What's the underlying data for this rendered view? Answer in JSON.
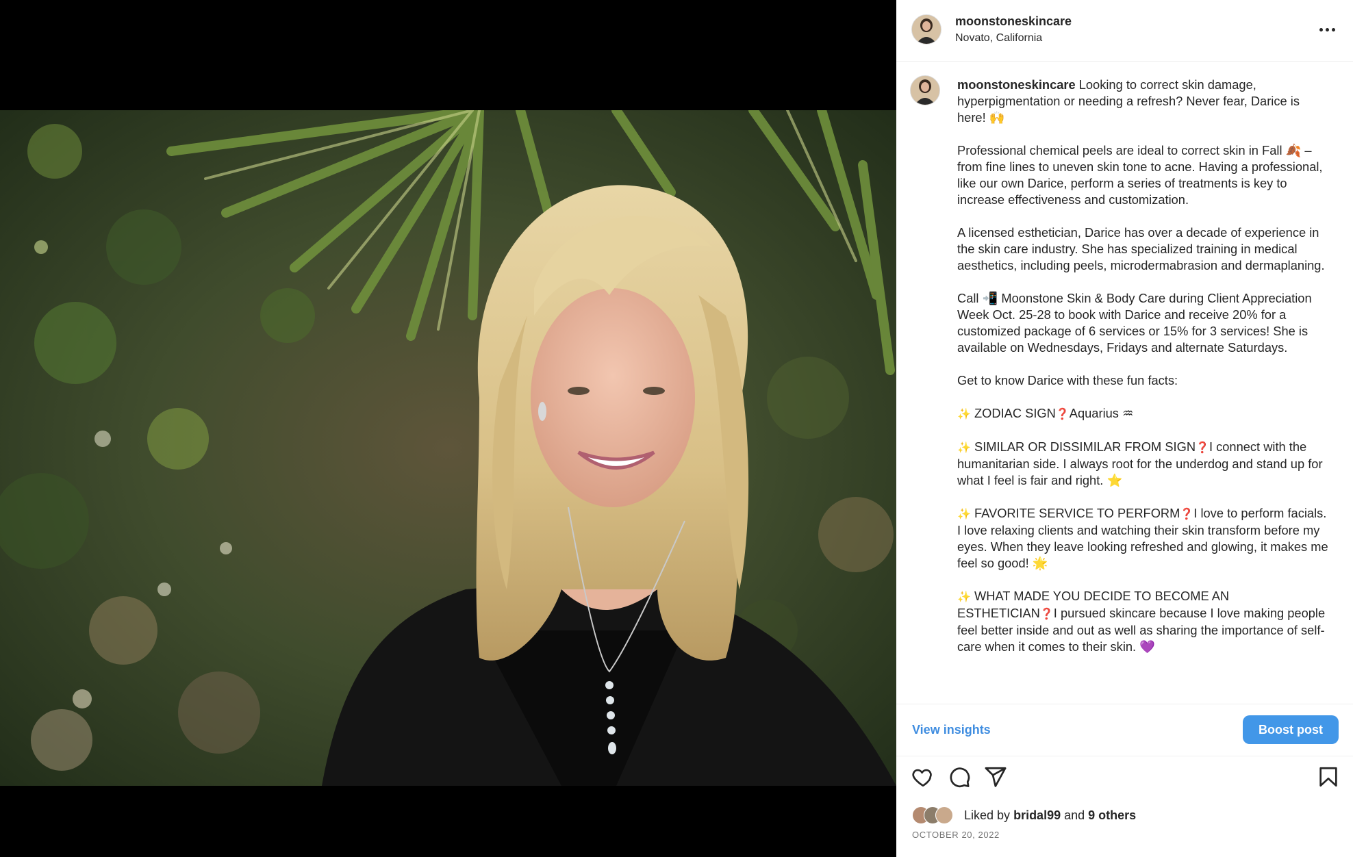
{
  "post": {
    "username": "moonstoneskincare",
    "location": "Novato, California",
    "more_icon": "more-horizontal-icon",
    "caption": {
      "intro": "Looking to correct skin damage, hyperpigmentation or needing a refresh? Never fear, Darice is here! 🙌",
      "p1": "Professional chemical peels are ideal to correct skin in Fall 🍂 – from fine lines to uneven skin tone to acne. Having a professional, like our own Darice, perform a series of treatments is key to increase effectiveness and customization.",
      "p2": "A licensed esthetician, Darice has over a decade of experience in the skin care industry. She has specialized training in medical aesthetics, including peels, microdermabrasion and dermaplaning.",
      "p3": "Call 📲 Moonstone Skin & Body Care during Client Appreciation Week Oct. 25-28 to book with Darice and receive 20% for a customized package of 6 services or 15% for 3 services! She is available on Wednesdays, Fridays and alternate Saturdays.",
      "p4": "Get to know Darice with these fun facts:",
      "f1_q": "ZODIAC SIGN",
      "f1_a": "Aquarius ♒",
      "f2_q": "SIMILAR OR DISSIMILAR FROM SIGN",
      "f2_a": "I connect with the humanitarian side. I always root for the underdog and stand up for what I feel is fair and right. ⭐",
      "f3_q": "FAVORITE SERVICE TO PERFORM",
      "f3_a": "I love to perform facials. I love relaxing clients and watching their skin transform before my eyes. When they leave looking refreshed and glowing, it makes me feel so good! 🌟",
      "f4_q": "WHAT MADE YOU DECIDE TO BECOME AN ESTHETICIAN",
      "f4_a": "I pursued skincare because I love making people feel better inside and out as well as sharing the importance of self-care when it comes to their skin. 💜",
      "sparkle": "✨",
      "question_mark": "❓"
    },
    "view_insights": "View insights",
    "boost_post": "Boost post",
    "likes": {
      "prefix": "Liked by",
      "user": "bridal99",
      "and": "and",
      "others": "9 others"
    },
    "date": "OCTOBER 20, 2022"
  },
  "colors": {
    "link_blue": "#3f8de0",
    "boost_blue": "#4297e8",
    "text": "#262626",
    "muted": "#737373"
  },
  "icons": [
    "heart-icon",
    "comment-icon",
    "share-icon",
    "bookmark-icon"
  ]
}
